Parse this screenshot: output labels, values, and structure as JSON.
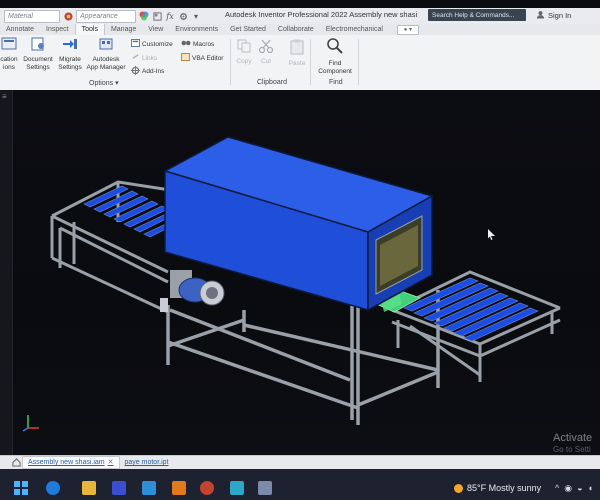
{
  "titlebar": {
    "material_placeholder": "Material",
    "appearance_placeholder": "Appearance",
    "fx_label": "fx",
    "app_title": "Autodesk Inventor Professional 2022   Assembly new shasi",
    "help_search": "Search Help & Commands...",
    "sign_in": "Sign In"
  },
  "tabs": [
    {
      "label": "Annotate"
    },
    {
      "label": "Inspect"
    },
    {
      "label": "Tools",
      "active": true
    },
    {
      "label": "Manage"
    },
    {
      "label": "View"
    },
    {
      "label": "Environments"
    },
    {
      "label": "Get Started"
    },
    {
      "label": "Collaborate"
    },
    {
      "label": "Electromechanical"
    }
  ],
  "ribbon": {
    "application_options": [
      "cation",
      "ions"
    ],
    "document_settings": [
      "Document",
      "Settings"
    ],
    "migrate_settings": [
      "Migrate",
      "Settings"
    ],
    "app_manager": [
      "Autodesk",
      "App Manager"
    ],
    "customize": "Customize",
    "links": "Links",
    "addins": "Add-Ins",
    "macros": "Macros",
    "vba_editor": "VBA Editor",
    "options_panel": "Options ▾",
    "copy": "Copy",
    "cut": "Cut",
    "paste": "Paste",
    "clipboard_panel": "Clipboard",
    "find_component": [
      "Find",
      "Component"
    ],
    "find_panel": "Find"
  },
  "viewport": {
    "activate_windows": "Activate",
    "activate_sub": "Go to Setti"
  },
  "doc_tabs": {
    "active": "Assembly new shasi.iam",
    "other": "paye motor.ipt"
  },
  "taskbar": {
    "weather": "85°F  Mostly sunny",
    "tray_up": "^"
  },
  "colors": {
    "enclosure_blue": "#1f4fd8",
    "roller_blue": "#1b4ee0",
    "frame_gray": "#9aa0a8",
    "motor_blue": "#3c63c4",
    "taskbar": "#1e2230"
  }
}
